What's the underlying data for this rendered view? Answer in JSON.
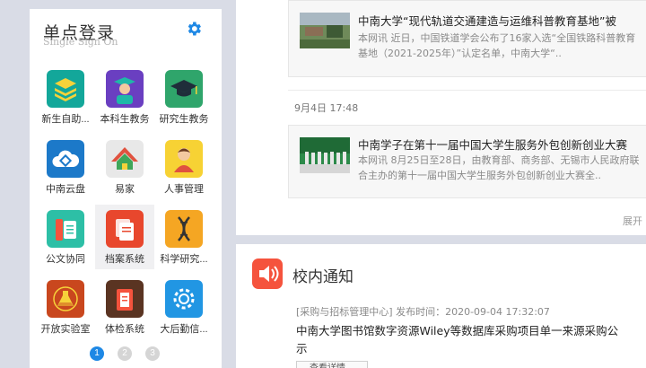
{
  "sso": {
    "title": "单点登录",
    "subtitle": "Single Sign On",
    "apps": [
      {
        "label": "新生自助..."
      },
      {
        "label": "本科生教务"
      },
      {
        "label": "研究生教务"
      },
      {
        "label": "中南云盘"
      },
      {
        "label": "易家"
      },
      {
        "label": "人事管理"
      },
      {
        "label": "公文协同"
      },
      {
        "label": "档案系统"
      },
      {
        "label": "科学研究..."
      },
      {
        "label": "开放实验室"
      },
      {
        "label": "体检系统"
      },
      {
        "label": "大后勤信..."
      }
    ],
    "pages": [
      "1",
      "2",
      "3"
    ],
    "current_page": "1",
    "accent_color": "#1e88e5"
  },
  "news": {
    "items": [
      {
        "title": "中南大学“现代轨道交通建造与运维科普教育基地”被",
        "desc": "本网讯 近日，中国铁道学会公布了16家入选“全国铁路科普教育基地（2021-2025年）”认定名单，中南大学“.."
      },
      {
        "date": "9月4日 17:48",
        "title": "中南学子在第十一届中国大学生服务外包创新创业大赛",
        "desc": "本网讯 8月25日至28日，由教育部、商务部、无锡市人民政府联合主办的第十一届中国大学生服务外包创新创业大赛全.."
      }
    ],
    "expand_label": "展开"
  },
  "notice": {
    "title": "校内通知",
    "meta": "[采购与招标管理中心] 发布时间：2020-09-04 17:32:07",
    "text": "中南大学图书馆数字资源Wiley等数据库采购项目单一来源采购公示",
    "detail_label": "查看详情",
    "icon_color": "#f5533d"
  }
}
